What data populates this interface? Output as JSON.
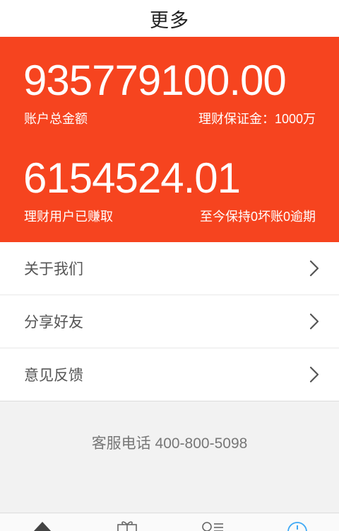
{
  "header": {
    "title": "更多"
  },
  "stats": {
    "total_amount": "935779100.00",
    "total_label": "账户总金额",
    "guarantee_label": "理财保证金：1000万",
    "earned_amount": "6154524.01",
    "earned_label": "理财用户已赚取",
    "record_label": "至今保持0坏账0逾期"
  },
  "menu": {
    "items": [
      {
        "label": "关于我们"
      },
      {
        "label": "分享好友"
      },
      {
        "label": "意见反馈"
      }
    ]
  },
  "footer": {
    "phone": "客服电话 400-800-5098"
  },
  "tabbar": {
    "icons": [
      "home-icon",
      "gift-icon",
      "user-list-icon",
      "info-icon"
    ],
    "active_color": "#3fa9f5"
  },
  "colors": {
    "accent": "#f6441f"
  }
}
